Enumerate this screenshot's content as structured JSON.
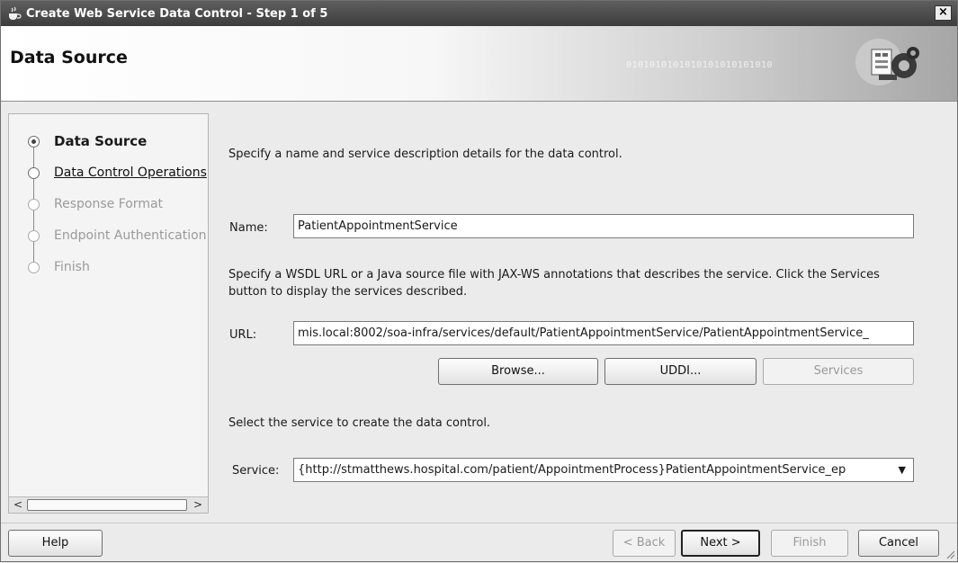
{
  "window": {
    "title": "Create Web Service Data Control - Step 1 of 5",
    "close_label": "×"
  },
  "header": {
    "title": "Data Source",
    "decoration_binary": "0101010101010101010101010"
  },
  "nav": {
    "items": [
      {
        "label": "Data Source",
        "state": "current"
      },
      {
        "label": "Data Control Operations",
        "state": "next"
      },
      {
        "label": "Response Format",
        "state": "disabled"
      },
      {
        "label": "Endpoint Authentication",
        "state": "disabled"
      },
      {
        "label": "Finish",
        "state": "disabled"
      }
    ],
    "scroll_left": "<",
    "scroll_right": ">"
  },
  "content": {
    "intro": "Specify a name and service description details for the data control.",
    "name_label": "Name:",
    "name_value": "PatientAppointmentService",
    "wsdl_help": "Specify a WSDL URL or a Java source file with JAX-WS annotations that describes the service. Click the Services button to display the services described.",
    "url_label": "URL:",
    "url_value": "mis.local:8002/soa-infra/services/default/PatientAppointmentService/PatientAppointmentService_",
    "browse_label": "Browse...",
    "uddi_label": "UDDI...",
    "services_label": "Services",
    "select_help": "Select the service to create the data control.",
    "service_label": "Service:",
    "service_value": "{http://stmatthews.hospital.com/patient/AppointmentProcess}PatientAppointmentService_ep"
  },
  "footer": {
    "help_label": "Help",
    "back_label": "< Back",
    "next_label": "Next >",
    "finish_label": "Finish",
    "cancel_label": "Cancel"
  },
  "colors": {
    "titlebar": "#4a4a4a",
    "disabled_text": "#9a9a9a"
  }
}
